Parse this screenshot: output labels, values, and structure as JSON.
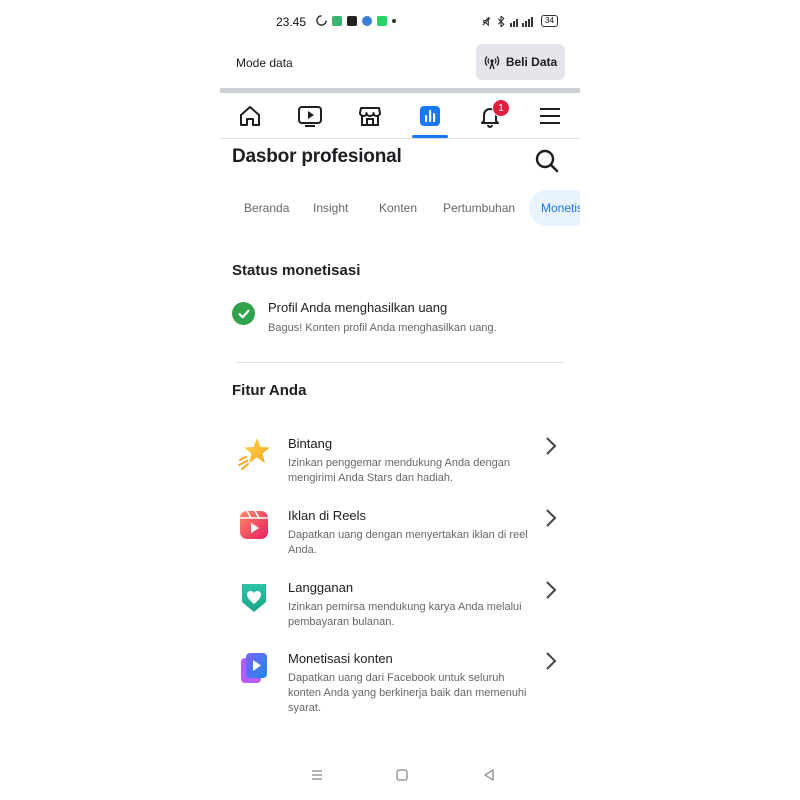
{
  "status_bar": {
    "time": "23.45",
    "battery": "34"
  },
  "data_bar": {
    "mode_label": "Mode data",
    "buy_label": "Beli Data"
  },
  "nav": {
    "items": [
      {
        "name": "home"
      },
      {
        "name": "video"
      },
      {
        "name": "marketplace"
      },
      {
        "name": "dashboard"
      },
      {
        "name": "notifications",
        "badge": "1"
      },
      {
        "name": "menu"
      }
    ]
  },
  "page": {
    "title": "Dasbor profesional"
  },
  "tabs": [
    "Beranda",
    "Insight",
    "Konten",
    "Pertumbuhan",
    "Monetis"
  ],
  "status_section": {
    "title": "Status monetisasi",
    "item_title": "Profil Anda menghasilkan uang",
    "item_desc": "Bagus! Konten profil Anda menghasilkan uang."
  },
  "features_section": {
    "title": "Fitur Anda",
    "items": [
      {
        "title": "Bintang",
        "desc": "Izinkan penggemar mendukung Anda dengan mengirimi Anda Stars dan hadiah.",
        "icon": "star-icon"
      },
      {
        "title": "Iklan di Reels",
        "desc": "Dapatkan uang dengan menyertakan iklan di reel Anda.",
        "icon": "reels-icon"
      },
      {
        "title": "Langganan",
        "desc": "Izinkan pemirsa mendukung karya Anda melalui pembayaran bulanan.",
        "icon": "heart-shield-icon"
      },
      {
        "title": "Monetisasi konten",
        "desc": "Dapatkan uang dari Facebook untuk seluruh konten Anda yang berkinerja baik dan memenuhi syarat.",
        "icon": "content-play-icon"
      }
    ]
  },
  "colors": {
    "accent": "#1877f2",
    "success": "#31a24c",
    "badge": "#e41e3f"
  }
}
